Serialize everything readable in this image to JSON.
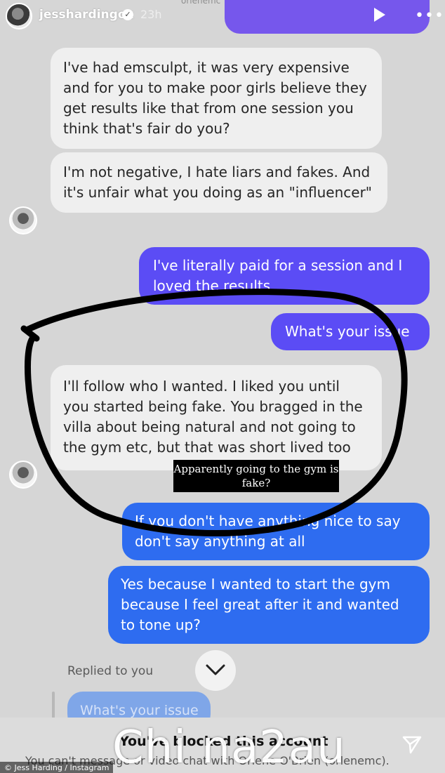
{
  "header": {
    "username": "jesshardingox",
    "time": "23h",
    "prev_name": "orlenemc",
    "verified_icon": "check-icon",
    "play_icon": "play-icon",
    "more_icon": "more-icon"
  },
  "messages": [
    {
      "from": "them",
      "text": "I've had emsculpt, it was very expensive and for you to make poor girls believe they get results like that from one session you think that's fair do you?"
    },
    {
      "from": "them",
      "text": "I'm not negative, I hate liars and fakes. And it's unfair what you doing as an \"influencer\""
    },
    {
      "from": "me",
      "text": "I've literally paid for a session and I loved the results"
    },
    {
      "from": "me",
      "text": "What's your issue"
    },
    {
      "from": "them",
      "text": "I'll follow who I wanted. I liked you until you started being fake. You bragged in the villa about being natural and not going to the gym etc, but that was short lived too"
    },
    {
      "from": "me",
      "text": "If you don't have anything nice to say don't say anything at all"
    },
    {
      "from": "me",
      "text": "Yes because I wanted to start the gym because I feel great after it and wanted to tone up?"
    }
  ],
  "caption": "Apparently going to the gym is fake?",
  "reply": {
    "label": "Replied to you",
    "quoted": "What's your issue"
  },
  "footer": {
    "blocked_title": "You've blocked this account",
    "blocked_sub": "You can't message or video chat with Orlene O'Brien (orlenemc).",
    "watermark": "Chi na2au",
    "credit": "© Jess Harding / Instagram"
  },
  "colors": {
    "purple": "#5b4cf5",
    "blue": "#2e6cf0",
    "incoming": "#efefef",
    "annotation": "#000000"
  }
}
